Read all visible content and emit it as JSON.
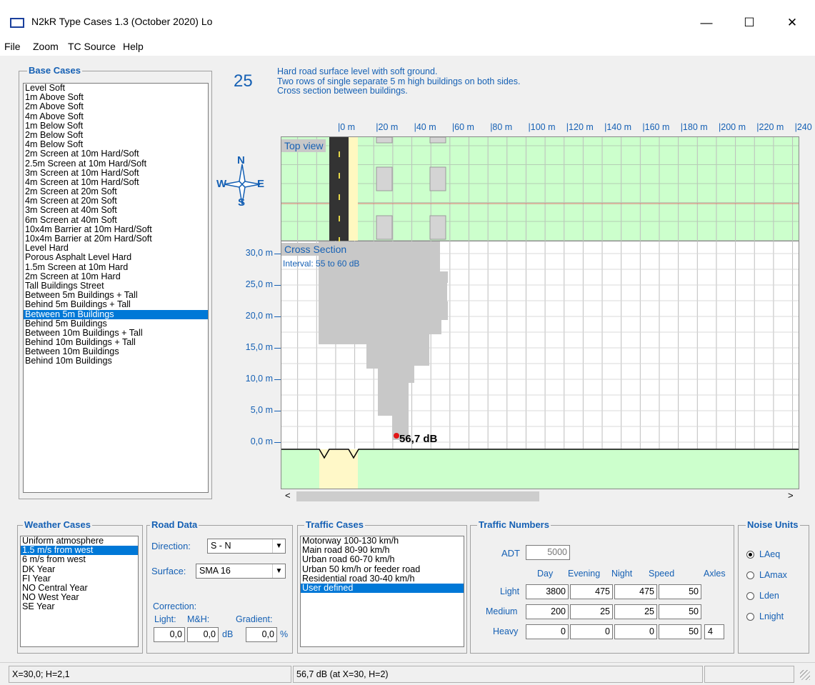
{
  "window": {
    "title": "N2kR Type Cases 1.3 (October 2020)   Lo",
    "minimize": "—",
    "maximize": "☐",
    "close": "✕"
  },
  "menu": [
    "File",
    "Zoom",
    "TC Source",
    "Help"
  ],
  "base_cases": {
    "title": "Base Cases",
    "items": [
      "Level Soft",
      "1m Above Soft",
      "2m Above Soft",
      "4m Above Soft",
      "1m Below Soft",
      "2m Below Soft",
      "4m Below Soft",
      "2m Screen at 10m Hard/Soft",
      "2.5m Screen at 10m Hard/Soft",
      "3m Screen at 10m Hard/Soft",
      "4m Screen at 10m Hard/Soft",
      "2m Screen at 20m Soft",
      "4m Screen at 20m Soft",
      "3m Screen at 40m Soft",
      "6m Screen at 40m Soft",
      "10x4m Barrier at 10m Hard/Soft",
      "10x4m Barrier at 20m Hard/Soft",
      "Level Hard",
      "Porous Asphalt Level Hard",
      "1.5m Screen at 10m Hard",
      "2m Screen at 10m Hard",
      "Tall Buildings Street",
      "Between 5m Buildings + Tall",
      "Behind  5m Buildings + Tall",
      "Between 5m Buildings",
      "Behind  5m Buildings",
      "Between 10m Buildings + Tall",
      "Behind  10m Buildings + Tall",
      "Between 10m Buildings",
      "Behind  10m Buildings"
    ],
    "selected_index": 24
  },
  "case": {
    "number": "25",
    "description": [
      "Hard road surface level with soft ground.",
      "Two rows of single separate 5 m high buildings on both sides.",
      "Cross section between buildings."
    ]
  },
  "plot": {
    "x_ticks": [
      "|0 m",
      "|20 m",
      "|40 m",
      "|60 m",
      "|80 m",
      "|100 m",
      "|120 m",
      "|140 m",
      "|160 m",
      "|180 m",
      "|200 m",
      "|220 m",
      "|240"
    ],
    "y_ticks": [
      "30,0 m",
      "25,0 m",
      "20,0 m",
      "15,0 m",
      "10,0 m",
      "5,0 m",
      "0,0 m"
    ],
    "top_view_label": "Top view",
    "cross_section_label": "Cross Section",
    "interval_label": "Interval: 55 to 60 dB",
    "point_label": "56,7 dB",
    "compass": {
      "n": "N",
      "s": "S",
      "e": "E",
      "w": "W"
    },
    "scroll_left": "<",
    "scroll_right": ">",
    "colors": {
      "grass": "#ccffcc",
      "road": "#333333",
      "building": "#d4d4d4",
      "zone": "#c8c8c8",
      "accent": "#1560b4"
    }
  },
  "weather": {
    "title": "Weather Cases",
    "items": [
      "Uniform atmosphere",
      "1.5 m/s from west",
      "6 m/s from west",
      "DK Year",
      "FI Year",
      "NO Central Year",
      "NO West Year",
      "SE Year"
    ],
    "selected_index": 1
  },
  "road": {
    "title": "Road Data",
    "direction_label": "Direction:",
    "direction_value": "S - N",
    "surface_label": "Surface:",
    "surface_value": "SMA 16",
    "correction_label": "Correction:",
    "light_label": "Light:",
    "mh_label": "M&H:",
    "gradient_label": "Gradient:",
    "light_value": "0,0",
    "mh_value": "0,0",
    "db_unit": "dB",
    "gradient_value": "0,0",
    "pct_unit": "%"
  },
  "traffic_cases": {
    "title": "Traffic Cases",
    "items": [
      "Motorway 100-130 km/h",
      "Main road 80-90 km/h",
      "Urban road 60-70 km/h",
      "Urban 50 km/h or feeder road",
      "Residential road 30-40 km/h",
      "User defined"
    ],
    "selected_index": 5
  },
  "traffic_numbers": {
    "title": "Traffic Numbers",
    "adt_label": "ADT",
    "adt_value": "5000",
    "headers": [
      "Day",
      "Evening",
      "Night",
      "Speed",
      "Axles"
    ],
    "rows": [
      {
        "label": "Light",
        "values": [
          "3800",
          "475",
          "475",
          "50"
        ]
      },
      {
        "label": "Medium",
        "values": [
          "200",
          "25",
          "25",
          "50"
        ]
      },
      {
        "label": "Heavy",
        "values": [
          "0",
          "0",
          "0",
          "50"
        ],
        "axles": "4"
      }
    ]
  },
  "noise_units": {
    "title": "Noise Units",
    "options": [
      "LAeq",
      "LAmax",
      "Lden",
      "Lnight"
    ],
    "selected_index": 0
  },
  "status": {
    "left": "X=30,0;  H=2,1",
    "middle": "56,7 dB  (at X=30, H=2)"
  }
}
